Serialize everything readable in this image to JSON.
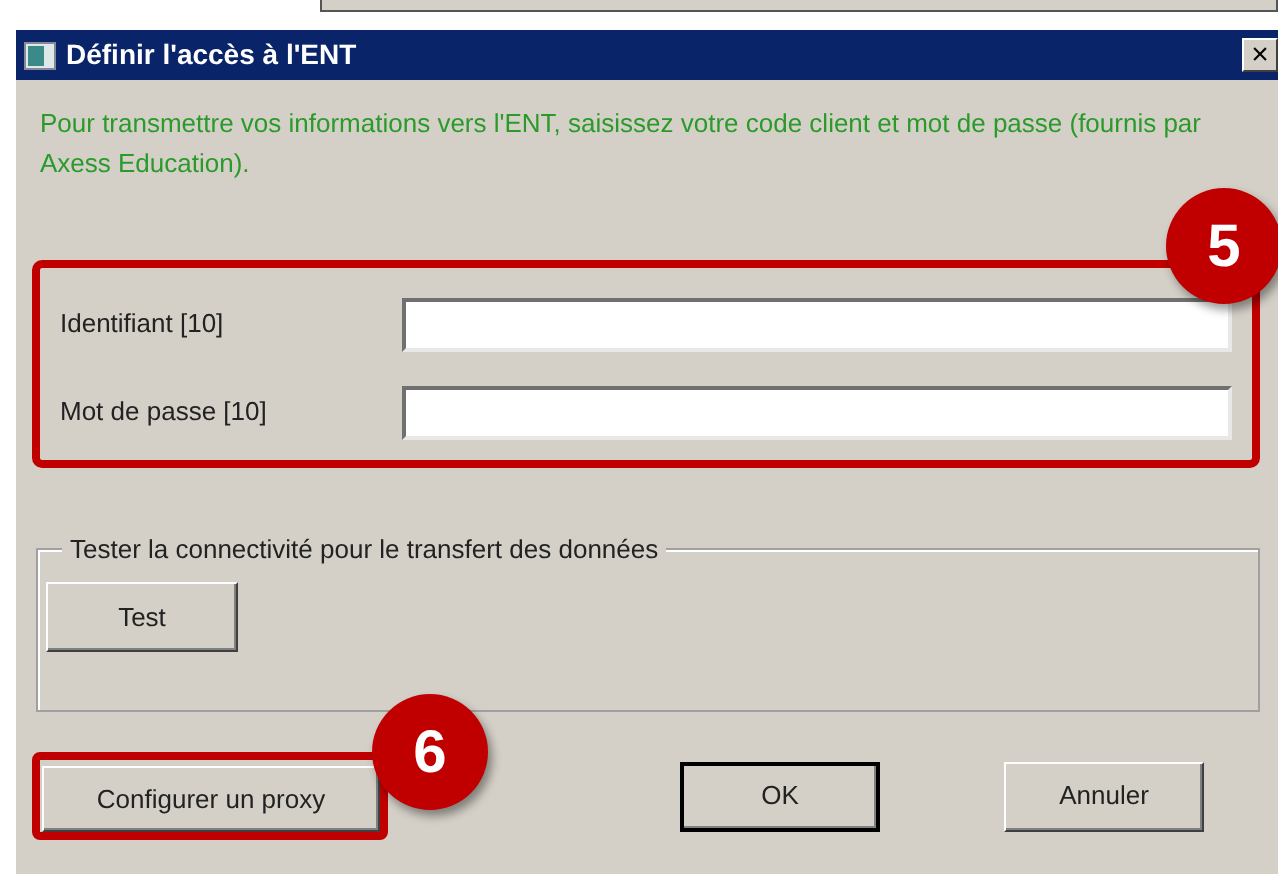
{
  "window": {
    "title": "Définir l'accès à l'ENT",
    "close": "×"
  },
  "instructions": "Pour transmettre vos informations vers l'ENT, saisissez votre code client et mot de passe (fournis par Axess Education).",
  "fields": [
    {
      "label": "Identifiant [10]"
    },
    {
      "label": "Mot de passe [10]"
    }
  ],
  "connectivity_group": {
    "legend": "Tester la connectivité pour le transfert des données",
    "button": "Test"
  },
  "buttons": [
    {
      "kind": "proxy",
      "label": "Configurer un proxy",
      "default": false
    },
    {
      "kind": "action",
      "label": "OK",
      "default": true
    },
    {
      "kind": "action",
      "label": "Annuler",
      "default": false
    }
  ],
  "callouts": [
    {
      "number": "5"
    },
    {
      "number": "6"
    }
  ]
}
